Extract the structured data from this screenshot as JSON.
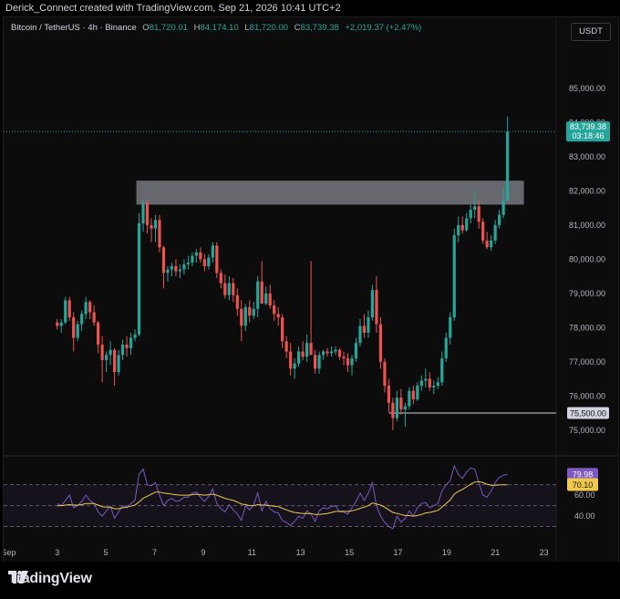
{
  "header": {
    "attribution": "Derick_Connect created with TradingView.com, Sep 21, 2026 10:41 UTC+2"
  },
  "legend": {
    "symbol": "Bitcoin / TetherUS · 4h · Binance",
    "open_label": "O",
    "open": "81,720.01",
    "high_label": "H",
    "high": "84,174.10",
    "low_label": "L",
    "low": "81,720.00",
    "close_label": "C",
    "close": "83,739.38",
    "change": "+2,019.37 (+2.47%)"
  },
  "currency_button": "USDT",
  "price_tag": {
    "price": "83,739.38",
    "countdown": "03:18:46"
  },
  "support_tag": "75,500.00",
  "rsi_tags": {
    "rsi": "79.98",
    "ma": "70.10"
  },
  "branding": {
    "logo_text": "TradingView"
  },
  "colors": {
    "up": "#26a69a",
    "down": "#ef5350",
    "rsi_line": "#7e57c2",
    "rsi_ma": "#f0c94b",
    "zone": "#b2b5be"
  },
  "chart_data": [
    {
      "type": "candlestick",
      "title": "Bitcoin / TetherUS · 4h · Binance",
      "ylim": [
        74700,
        85800
      ],
      "y_ticks": [
        "75,000.00",
        "76,000.00",
        "77,000.00",
        "78,000.00",
        "79,000.00",
        "80,000.00",
        "81,000.00",
        "82,000.00",
        "83,000.00",
        "84,000.00",
        "85,000.00"
      ],
      "y_tick_values": [
        75000,
        76000,
        77000,
        78000,
        79000,
        80000,
        81000,
        82000,
        83000,
        84000,
        85000
      ],
      "x_ticks": [
        "Sep",
        "3",
        "5",
        "7",
        "9",
        "11",
        "13",
        "15",
        "17",
        "19",
        "21",
        "23"
      ],
      "x_tick_days": [
        1,
        3,
        5,
        7,
        9,
        11,
        13,
        15,
        17,
        19,
        21,
        23
      ],
      "x_range_days": [
        0.8,
        23.5
      ],
      "grid": false,
      "candle_interval": "4h",
      "ohlc": [
        [
          78150,
          78250,
          77950,
          78050
        ],
        [
          78050,
          78250,
          77850,
          78150
        ],
        [
          78150,
          78900,
          78100,
          78800
        ],
        [
          78800,
          78900,
          78200,
          78300
        ],
        [
          78300,
          78450,
          77300,
          77700
        ],
        [
          77700,
          78200,
          77600,
          78100
        ],
        [
          78100,
          78500,
          77900,
          78400
        ],
        [
          78400,
          78900,
          78250,
          78750
        ],
        [
          78750,
          78800,
          78250,
          78450
        ],
        [
          78450,
          78650,
          78050,
          78150
        ],
        [
          78150,
          78200,
          77250,
          77500
        ],
        [
          77500,
          77750,
          76400,
          77050
        ],
        [
          77050,
          77300,
          76700,
          77200
        ],
        [
          77200,
          77600,
          76900,
          77350
        ],
        [
          77350,
          77400,
          76300,
          76700
        ],
        [
          76700,
          77350,
          76600,
          77200
        ],
        [
          77200,
          77650,
          77050,
          77500
        ],
        [
          77500,
          77750,
          77150,
          77400
        ],
        [
          77400,
          77850,
          77200,
          77700
        ],
        [
          77700,
          77950,
          77600,
          77800
        ],
        [
          77800,
          81350,
          77750,
          81050
        ],
        [
          81050,
          81750,
          80800,
          81650
        ],
        [
          81650,
          81700,
          80750,
          81000
        ],
        [
          81000,
          81200,
          80500,
          80900
        ],
        [
          80900,
          81300,
          80500,
          81150
        ],
        [
          81150,
          81300,
          80200,
          80350
        ],
        [
          80350,
          80400,
          79150,
          79600
        ],
        [
          79600,
          79800,
          79350,
          79700
        ],
        [
          79700,
          79900,
          79500,
          79800
        ],
        [
          79800,
          80000,
          79500,
          79650
        ],
        [
          79650,
          79850,
          79450,
          79700
        ],
        [
          79700,
          80000,
          79550,
          79850
        ],
        [
          79850,
          80100,
          79700,
          79900
        ],
        [
          79900,
          80200,
          79800,
          80100
        ],
        [
          80100,
          80300,
          79900,
          80200
        ],
        [
          80200,
          80350,
          79900,
          80000
        ],
        [
          80000,
          80150,
          79650,
          79800
        ],
        [
          79800,
          80150,
          79700,
          80050
        ],
        [
          80050,
          80500,
          79900,
          80400
        ],
        [
          80400,
          80500,
          79450,
          79600
        ],
        [
          79600,
          79700,
          79150,
          79300
        ],
        [
          79300,
          79550,
          78850,
          78950
        ],
        [
          78950,
          79500,
          78800,
          79300
        ],
        [
          79300,
          79450,
          78750,
          78950
        ],
        [
          78950,
          79150,
          78350,
          78550
        ],
        [
          78550,
          78800,
          77600,
          78050
        ],
        [
          78050,
          78700,
          77900,
          78600
        ],
        [
          78600,
          78800,
          78150,
          78350
        ],
        [
          78350,
          78750,
          78250,
          78550
        ],
        [
          78550,
          79500,
          78300,
          79350
        ],
        [
          79350,
          79950,
          79100,
          78700
        ],
        [
          78700,
          79200,
          78650,
          79000
        ],
        [
          79000,
          79250,
          78550,
          78650
        ],
        [
          78650,
          78800,
          78200,
          78400
        ],
        [
          78400,
          78600,
          78050,
          78300
        ],
        [
          78300,
          78400,
          77400,
          77600
        ],
        [
          77600,
          77750,
          77100,
          77300
        ],
        [
          77300,
          77550,
          76600,
          76800
        ],
        [
          76800,
          77100,
          76500,
          76950
        ],
        [
          76950,
          77450,
          76850,
          77300
        ],
        [
          77300,
          77600,
          77050,
          77150
        ],
        [
          77150,
          77800,
          77000,
          77550
        ],
        [
          77550,
          79950,
          77300,
          77200
        ],
        [
          77200,
          77350,
          76650,
          76800
        ],
        [
          76800,
          77300,
          76650,
          77200
        ],
        [
          77200,
          77350,
          77050,
          77300
        ],
        [
          77300,
          77400,
          77150,
          77250
        ],
        [
          77250,
          77450,
          77150,
          77300
        ],
        [
          77300,
          77450,
          77200,
          77350
        ],
        [
          77350,
          77400,
          77050,
          77150
        ],
        [
          77150,
          77300,
          76900,
          77100
        ],
        [
          77100,
          77250,
          76700,
          76900
        ],
        [
          76900,
          77200,
          76600,
          77100
        ],
        [
          77100,
          77700,
          77000,
          77550
        ],
        [
          77550,
          78250,
          77450,
          78050
        ],
        [
          78050,
          78400,
          77700,
          77850
        ],
        [
          77850,
          78500,
          77700,
          78300
        ],
        [
          78300,
          79250,
          78200,
          79100
        ],
        [
          79100,
          79500,
          77850,
          78100
        ],
        [
          78100,
          78300,
          76800,
          77000
        ],
        [
          77000,
          77100,
          76100,
          76300
        ],
        [
          76300,
          76500,
          75500,
          75800
        ],
        [
          75800,
          75950,
          75000,
          75350
        ],
        [
          75350,
          76150,
          75250,
          75950
        ],
        [
          75950,
          76200,
          75450,
          75600
        ],
        [
          75600,
          75800,
          75100,
          75700
        ],
        [
          75700,
          76250,
          75600,
          76150
        ],
        [
          76150,
          76300,
          75750,
          75900
        ],
        [
          75900,
          76400,
          75850,
          76300
        ],
        [
          76300,
          76600,
          76150,
          76450
        ],
        [
          76450,
          76800,
          76250,
          76500
        ],
        [
          76500,
          76700,
          76150,
          76250
        ],
        [
          76250,
          76450,
          76050,
          76300
        ],
        [
          76300,
          76550,
          76200,
          76400
        ],
        [
          76400,
          77300,
          76300,
          77100
        ],
        [
          77100,
          77850,
          77000,
          77700
        ],
        [
          77700,
          78450,
          77500,
          78300
        ],
        [
          78300,
          80900,
          78200,
          80700
        ],
        [
          80700,
          81250,
          80500,
          81000
        ],
        [
          81000,
          81250,
          80750,
          80850
        ],
        [
          80850,
          81350,
          80800,
          81200
        ],
        [
          81200,
          81600,
          81050,
          81450
        ],
        [
          81450,
          82000,
          81200,
          81550
        ],
        [
          81550,
          81750,
          80900,
          81100
        ],
        [
          81100,
          81200,
          80450,
          80550
        ],
        [
          80550,
          80800,
          80300,
          80350
        ],
        [
          80350,
          80700,
          80250,
          80550
        ],
        [
          80550,
          81150,
          80450,
          81000
        ],
        [
          81000,
          81450,
          80900,
          81300
        ],
        [
          81300,
          82100,
          81200,
          81720
        ],
        [
          81720,
          84174,
          81720,
          83739
        ]
      ],
      "resistance_zone": [
        81600,
        82300
      ],
      "support_level": 75500,
      "last_price": 83739.38
    },
    {
      "type": "line",
      "title": "RSI",
      "ylim": [
        20,
        95
      ],
      "y_ticks": [
        "40.00",
        "60.00"
      ],
      "y_tick_values": [
        40,
        60
      ],
      "bands": [
        30,
        50,
        70
      ],
      "series": [
        {
          "values": [
            52,
            50,
            55,
            60,
            48,
            50,
            54,
            60,
            55,
            52,
            44,
            40,
            45,
            49,
            38,
            44,
            50,
            48,
            52,
            55,
            80,
            85,
            70,
            69,
            72,
            60,
            50,
            55,
            57,
            54,
            55,
            58,
            58,
            62,
            63,
            58,
            54,
            59,
            66,
            52,
            47,
            44,
            51,
            46,
            42,
            36,
            50,
            46,
            51,
            62,
            45,
            54,
            47,
            44,
            43,
            36,
            34,
            31,
            35,
            40,
            38,
            45,
            42,
            35,
            45,
            48,
            47,
            49,
            50,
            44,
            44,
            42,
            48,
            54,
            62,
            55,
            62,
            72,
            50,
            40,
            34,
            30,
            28,
            40,
            34,
            38,
            45,
            40,
            48,
            52,
            53,
            48,
            50,
            52,
            64,
            70,
            74,
            88,
            80,
            76,
            82,
            86,
            85,
            72,
            60,
            58,
            64,
            72,
            77,
            79,
            79.98
          ]
        },
        {
          "values": [
            50,
            50,
            50.5,
            51,
            50.5,
            50.5,
            51,
            52,
            52,
            52,
            50.5,
            49,
            48.5,
            48.5,
            47,
            47,
            48,
            48.5,
            49.5,
            50.5,
            53.5,
            57,
            59,
            61,
            63,
            63,
            62,
            61.5,
            61,
            60.5,
            60,
            60,
            60,
            60.5,
            61,
            60.5,
            60,
            60.5,
            61,
            60,
            58.5,
            57,
            56,
            55,
            53.5,
            51.5,
            51,
            50,
            50,
            51,
            50.5,
            50.5,
            50,
            49.5,
            49,
            47.5,
            46,
            44.5,
            43.5,
            43,
            42.5,
            42.5,
            42.5,
            41.5,
            41.5,
            42,
            42.5,
            43.5,
            44.5,
            44.5,
            44.5,
            44.5,
            45,
            46,
            47.5,
            48.5,
            50,
            52.5,
            51.5,
            50.5,
            48.5,
            46,
            43.5,
            42.5,
            41.5,
            40.5,
            40.5,
            40,
            40.5,
            41.5,
            43,
            43.5,
            44.5,
            45.5,
            48.5,
            52,
            55.5,
            61,
            63.5,
            65.5,
            68,
            70.5,
            72.5,
            73,
            72,
            70.5,
            69.5,
            69.5,
            70,
            70,
            70.1
          ]
        }
      ]
    }
  ]
}
